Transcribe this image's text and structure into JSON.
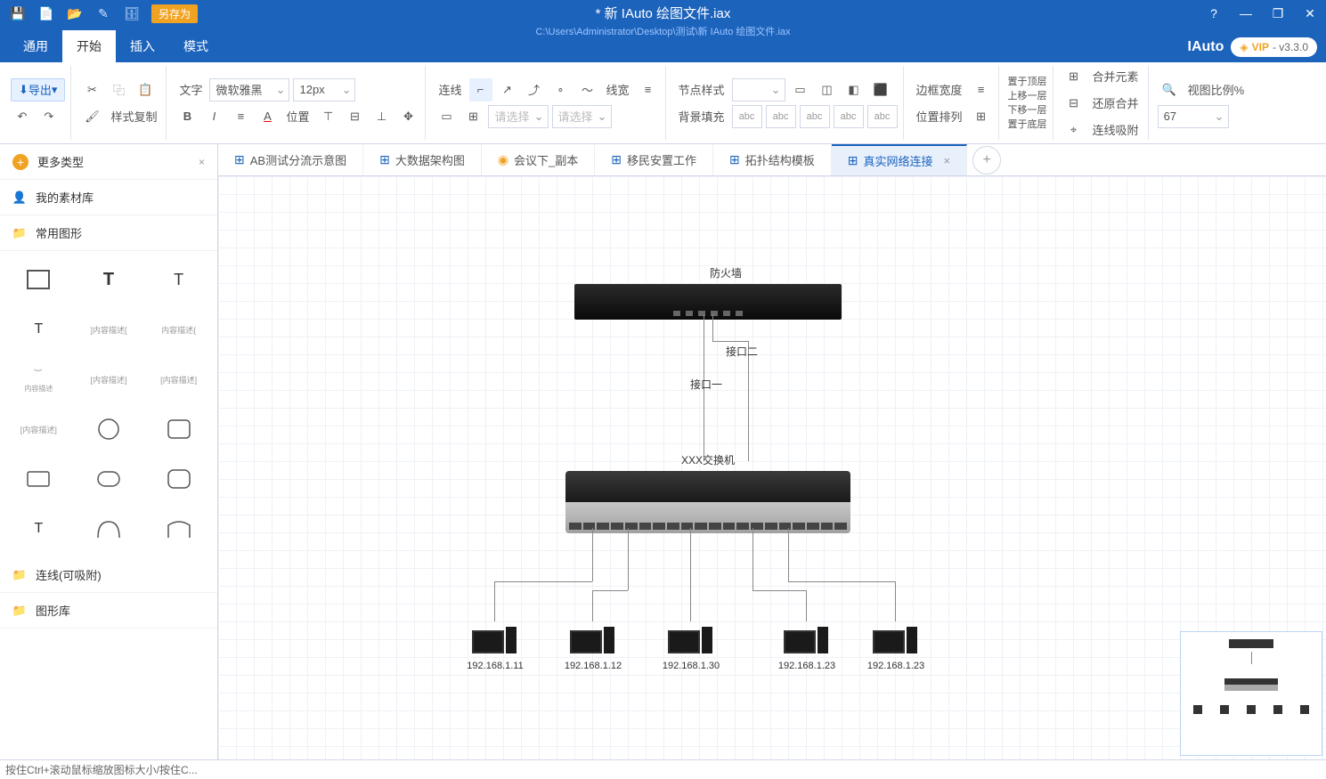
{
  "qat": {
    "saveas": "另存为"
  },
  "title": {
    "file": "* 新 IAuto 绘图文件.iax",
    "path": "C:\\Users\\Administrator\\Desktop\\测试\\新 IAuto 绘图文件.iax"
  },
  "brand": {
    "name": "IAuto",
    "vip": "VIP",
    "version": "- v3.3.0"
  },
  "menu": {
    "items": [
      "通用",
      "开始",
      "插入",
      "模式"
    ],
    "active": 1
  },
  "ribbon": {
    "export": "导出",
    "style_copy": "样式复制",
    "text": "文字",
    "font": "微软雅黑",
    "size": "12px",
    "position": "位置",
    "line": "连线",
    "linewidth": "线宽",
    "nodestyle": "节点样式",
    "select1": "请选择",
    "select2": "请选择",
    "bgfill": "背景填充",
    "abc": "abc",
    "borderwidth": "边框宽度",
    "posarr": "位置排列",
    "layers": [
      "置于顶层",
      "上移一层",
      "下移一层",
      "置于底层"
    ],
    "merge": "合并元素",
    "unmerge": "还原合并",
    "snap": "连线吸附",
    "viewscale": "视图比例%",
    "scale": "67"
  },
  "sidebar": {
    "more": "更多类型",
    "mylib": "我的素材库",
    "common": "常用图形",
    "lines": "连线(可吸附)",
    "shapelib": "图形库",
    "desc": "内容描述"
  },
  "tabs": [
    {
      "label": "AB测试分流示意图"
    },
    {
      "label": "大数据架构图"
    },
    {
      "label": "会议下_副本"
    },
    {
      "label": "移民安置工作"
    },
    {
      "label": "拓扑结构模板"
    },
    {
      "label": "真实网络连接",
      "active": true
    }
  ],
  "diagram": {
    "firewall": "防火墙",
    "port1": "接口一",
    "port2": "接口二",
    "switch": "XXX交换机",
    "pcs": [
      "192.168.1.11",
      "192.168.1.12",
      "192.168.1.30",
      "192.168.1.23",
      "192.168.1.23"
    ]
  },
  "status": "按住Ctrl+滚动鼠标缩放图标大小/按住C..."
}
